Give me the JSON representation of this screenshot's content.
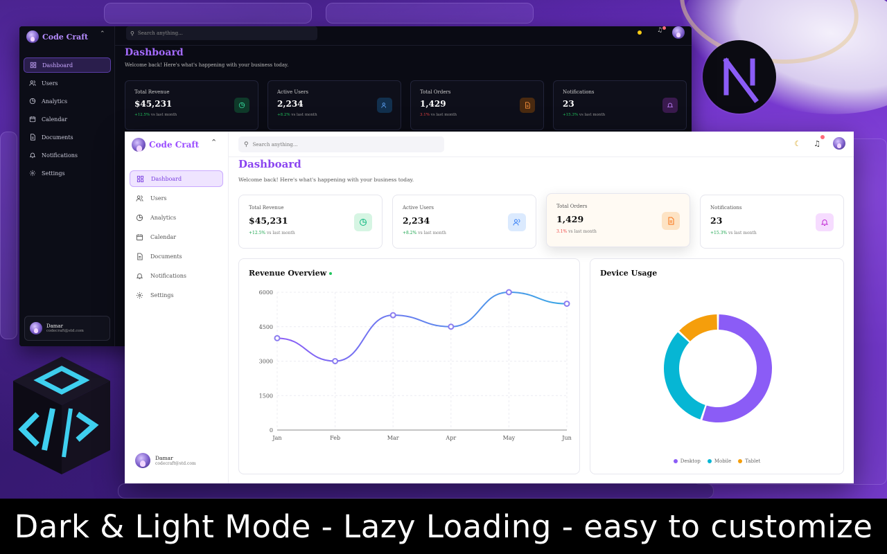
{
  "brand": "Code Craft",
  "dark": {
    "search_placeholder": "Search anything...",
    "nav": [
      "Dashboard",
      "Users",
      "Analytics",
      "Calendar",
      "Documents",
      "Notifications",
      "Settings"
    ],
    "page_title": "Dashboard",
    "welcome": "Welcome back! Here's what's happening with your business today.",
    "cards": [
      {
        "title": "Total Revenue",
        "value": "$45,231",
        "change": "+12.5%",
        "suffix": " vs last month",
        "change_color": "#22c55e"
      },
      {
        "title": "Active Users",
        "value": "2,234",
        "change": "+8.2%",
        "suffix": " vs last month",
        "change_color": "#22c55e"
      },
      {
        "title": "Total Orders",
        "value": "1,429",
        "change": "3.1%",
        "suffix": " vs last month",
        "change_color": "#ef4444"
      },
      {
        "title": "Notifications",
        "value": "23",
        "change": "+15.3%",
        "suffix": " vs last month",
        "change_color": "#22c55e"
      }
    ],
    "user": {
      "name": "Damar",
      "email": "codecraft@std.com"
    }
  },
  "light": {
    "search_placeholder": "Search anything...",
    "nav": [
      "Dashboard",
      "Users",
      "Analytics",
      "Calendar",
      "Documents",
      "Notifications",
      "Settings"
    ],
    "page_title": "Dashboard",
    "welcome": "Welcome back! Here's what's happening with your business today.",
    "cards": [
      {
        "title": "Total Revenue",
        "value": "$45,231",
        "change": "+12.5%",
        "suffix": " vs last month",
        "change_color": "#16a34a"
      },
      {
        "title": "Active Users",
        "value": "2,234",
        "change": "+8.2%",
        "suffix": " vs last month",
        "change_color": "#16a34a"
      },
      {
        "title": "Total Orders",
        "value": "1,429",
        "change": "3.1%",
        "suffix": " vs last month",
        "change_color": "#ef4444"
      },
      {
        "title": "Notifications",
        "value": "23",
        "change": "+15.3%",
        "suffix": " vs last month",
        "change_color": "#16a34a"
      }
    ],
    "user": {
      "name": "Damar",
      "email": "codecraft@std.com"
    },
    "revenue_title": "Revenue Overview",
    "device_title": "Device Usage"
  },
  "colors": {
    "accent": "#8b45f0",
    "line": "#4aa3e8",
    "desktop": "#8b5cf6",
    "mobile": "#06b6d4",
    "tablet": "#f59e0b"
  },
  "chart_data": [
    {
      "type": "line",
      "title": "Revenue Overview",
      "x": [
        "Jan",
        "Feb",
        "Mar",
        "Apr",
        "May",
        "Jun"
      ],
      "values": [
        4000,
        3000,
        5000,
        4500,
        6000,
        5500
      ],
      "yticks": [
        "6000",
        "4500",
        "3000",
        "1500",
        "0"
      ],
      "ylim": [
        0,
        6000
      ],
      "grid": true
    },
    {
      "type": "pie",
      "title": "Device Usage",
      "labels": [
        "Desktop",
        "Mobile",
        "Tablet"
      ],
      "values": [
        55,
        32,
        13
      ],
      "donut": true,
      "legend": "bottom"
    }
  ],
  "banner": "Dark & Light Mode - Lazy Loading - easy to customize"
}
